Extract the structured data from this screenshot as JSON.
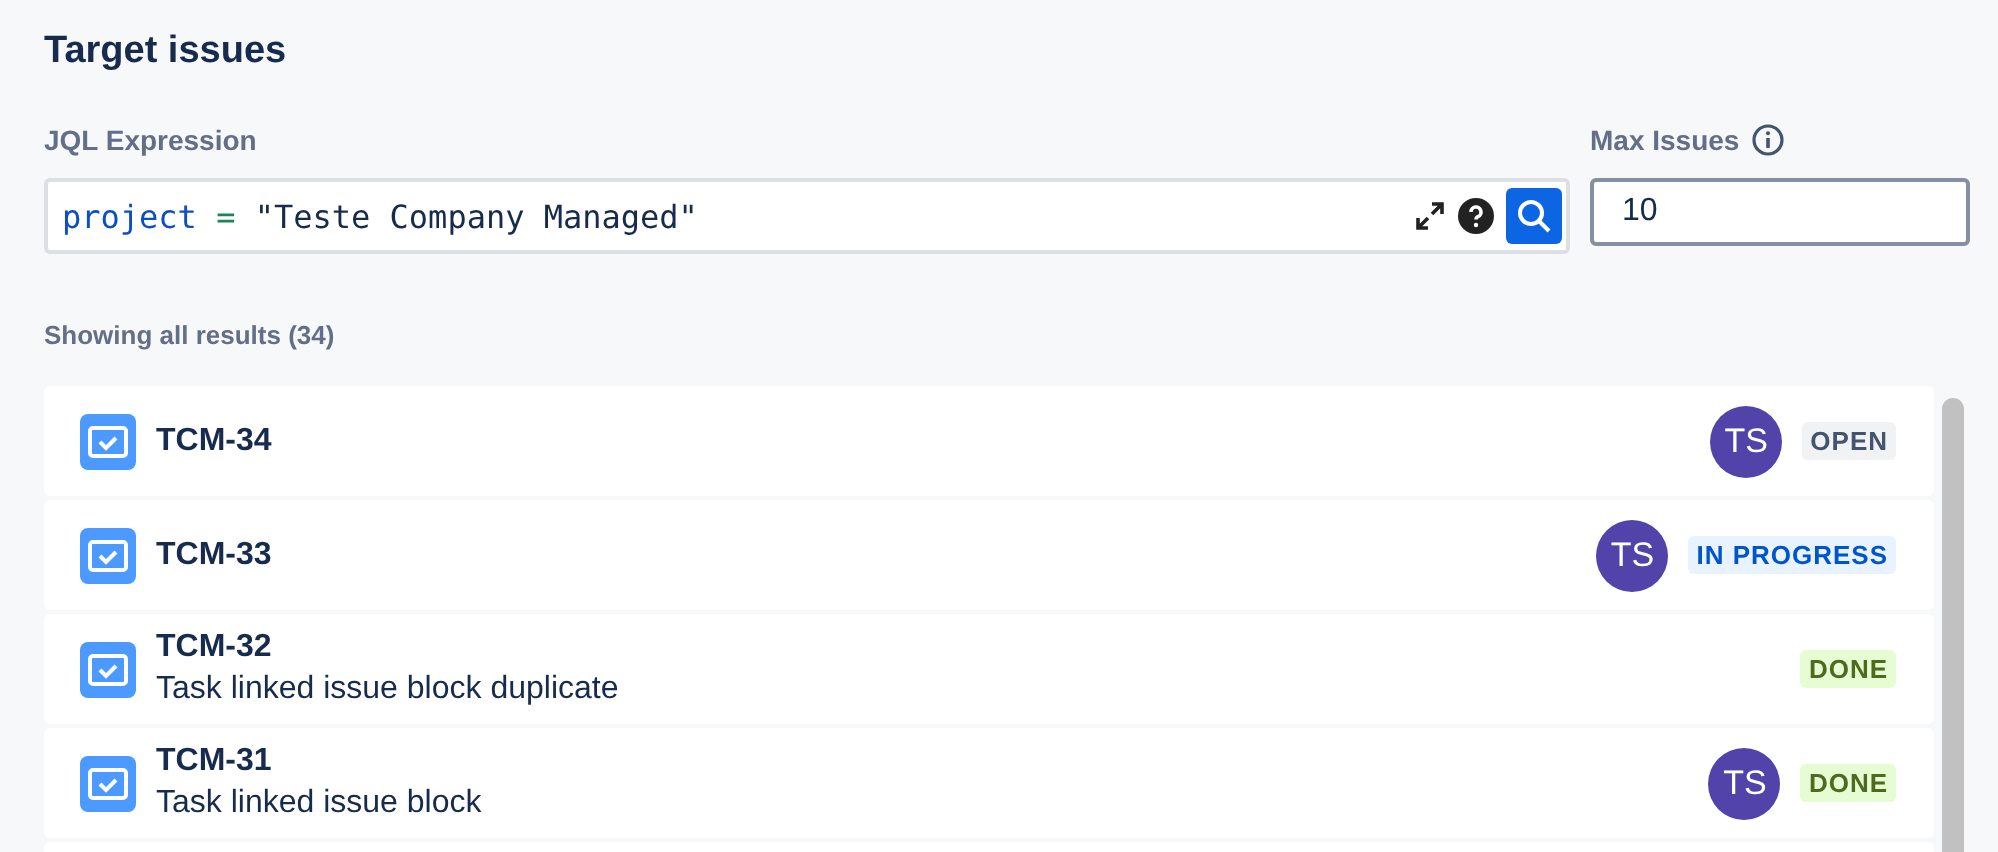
{
  "title": "Target issues",
  "jql": {
    "label": "JQL Expression",
    "tokens": [
      {
        "kind": "keyword",
        "text": "project"
      },
      {
        "kind": "operator",
        "text": "="
      },
      {
        "kind": "string",
        "text": "\"Teste Company Managed\""
      }
    ]
  },
  "max_issues": {
    "label": "Max Issues",
    "value": "10"
  },
  "results_summary": "Showing all results (34)",
  "issues": [
    {
      "key": "TCM-34",
      "assignee": "TS",
      "status": {
        "kind": "open",
        "label": "OPEN"
      }
    },
    {
      "key": "TCM-33",
      "assignee": "TS",
      "status": {
        "kind": "in_progress",
        "label": "IN PROGRESS"
      }
    },
    {
      "key": "TCM-32",
      "summary": "Task linked issue block duplicate",
      "status": {
        "kind": "done",
        "label": "DONE"
      }
    },
    {
      "key": "TCM-31",
      "summary": "Task linked issue block",
      "assignee": "TS",
      "status": {
        "kind": "done",
        "label": "DONE"
      }
    }
  ]
}
